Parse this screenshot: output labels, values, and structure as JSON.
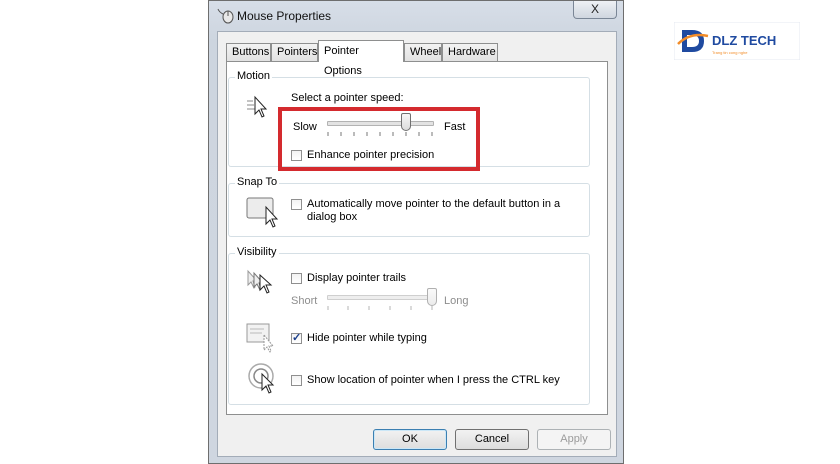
{
  "window": {
    "title": "Mouse Properties",
    "close_symbol": "X",
    "tabs": [
      {
        "label": "Buttons",
        "active": false
      },
      {
        "label": "Pointers",
        "active": false
      },
      {
        "label": "Pointer Options",
        "active": true
      },
      {
        "label": "Wheel",
        "active": false
      },
      {
        "label": "Hardware",
        "active": false
      }
    ]
  },
  "motion": {
    "group_label": "Motion",
    "speed_label": "Select a pointer speed:",
    "slow_label": "Slow",
    "fast_label": "Fast",
    "speed_level": 0.75,
    "enhance_precision_label": "Enhance pointer precision",
    "enhance_precision_checked": false
  },
  "snap_to": {
    "group_label": "Snap To",
    "auto_move_label_line1": "Automatically move pointer to the default button in a",
    "auto_move_label_line2": "dialog box",
    "auto_move_checked": false
  },
  "visibility": {
    "group_label": "Visibility",
    "trails_label": "Display pointer trails",
    "trails_checked": false,
    "short_label": "Short",
    "long_label": "Long",
    "trail_length_level": 1.0,
    "hide_while_typing_label": "Hide pointer while typing",
    "hide_while_typing_checked": true,
    "show_location_label": "Show location of pointer when I press the CTRL key",
    "show_location_checked": false
  },
  "buttons": {
    "ok": "OK",
    "cancel": "Cancel",
    "apply": "Apply"
  },
  "logo": {
    "text": "DLZ TECH",
    "tagline": "Trang tin cong nghe",
    "colors": {
      "brand_orange": "#f28c28",
      "brand_blue": "#1f4aa0"
    }
  },
  "colors": {
    "highlight_border": "#d42a2e"
  }
}
